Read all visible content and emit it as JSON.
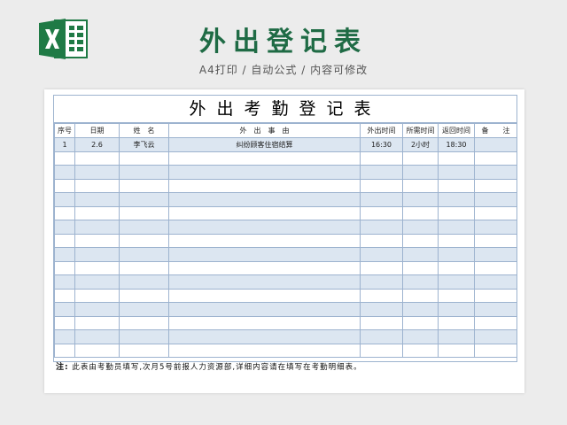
{
  "header": {
    "title": "外出登记表",
    "subtitle": "A4打印 / 自动公式 / 内容可修改"
  },
  "document": {
    "title": "外出考勤登记表",
    "columns": [
      "序号",
      "日期",
      "姓　名",
      "外　出　事　由",
      "外出时间",
      "所需时间",
      "返回时间",
      "备　　注"
    ],
    "rows": [
      [
        "1",
        "2.6",
        "李飞云",
        "纠纷顾客住宿结算",
        "16:30",
        "2小时",
        "18:30",
        ""
      ],
      [
        "",
        "",
        "",
        "",
        "",
        "",
        "",
        ""
      ],
      [
        "",
        "",
        "",
        "",
        "",
        "",
        "",
        ""
      ],
      [
        "",
        "",
        "",
        "",
        "",
        "",
        "",
        ""
      ],
      [
        "",
        "",
        "",
        "",
        "",
        "",
        "",
        ""
      ],
      [
        "",
        "",
        "",
        "",
        "",
        "",
        "",
        ""
      ],
      [
        "",
        "",
        "",
        "",
        "",
        "",
        "",
        ""
      ],
      [
        "",
        "",
        "",
        "",
        "",
        "",
        "",
        ""
      ],
      [
        "",
        "",
        "",
        "",
        "",
        "",
        "",
        ""
      ],
      [
        "",
        "",
        "",
        "",
        "",
        "",
        "",
        ""
      ],
      [
        "",
        "",
        "",
        "",
        "",
        "",
        "",
        ""
      ],
      [
        "",
        "",
        "",
        "",
        "",
        "",
        "",
        ""
      ],
      [
        "",
        "",
        "",
        "",
        "",
        "",
        "",
        ""
      ],
      [
        "",
        "",
        "",
        "",
        "",
        "",
        "",
        ""
      ],
      [
        "",
        "",
        "",
        "",
        "",
        "",
        "",
        ""
      ],
      [
        "",
        "",
        "",
        "",
        "",
        "",
        "",
        ""
      ]
    ],
    "note_label": "注:",
    "note_text": "此表由考勤员填写,次月5号前报人力资源部,详细内容请在填写在考勤明细表。"
  },
  "icons": {
    "logo": "excel-logo-icon"
  },
  "colors": {
    "brand": "#1f6b45",
    "grid": "#9db3cf",
    "alt_row": "#dce6f1"
  }
}
